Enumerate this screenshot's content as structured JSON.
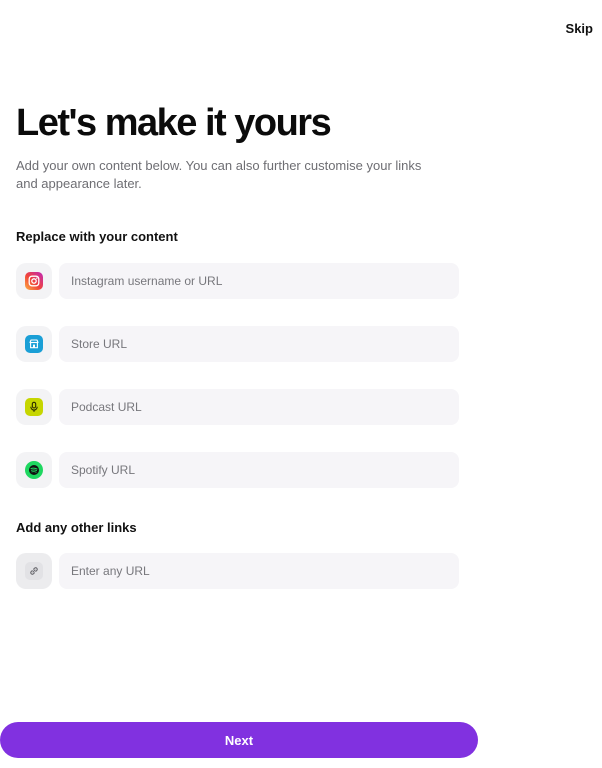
{
  "header": {
    "skip_label": "Skip"
  },
  "title": "Let's make it yours",
  "subtitle": "Add your own content below. You can also further customise your links and appearance later.",
  "replace_section": {
    "label": "Replace with your content",
    "items": [
      {
        "icon": "instagram-icon",
        "placeholder": "Instagram username or URL",
        "value": ""
      },
      {
        "icon": "store-icon",
        "placeholder": "Store URL",
        "value": ""
      },
      {
        "icon": "podcast-icon",
        "placeholder": "Podcast URL",
        "value": ""
      },
      {
        "icon": "spotify-icon",
        "placeholder": "Spotify URL",
        "value": ""
      }
    ]
  },
  "other_section": {
    "label": "Add any other links",
    "items": [
      {
        "icon": "link-icon",
        "placeholder": "Enter any URL",
        "value": ""
      }
    ]
  },
  "footer": {
    "next_label": "Next"
  },
  "colors": {
    "accent": "#8131e0",
    "instagram": "#e1306c",
    "store": "#1a9fd6",
    "podcast": "#c6d600",
    "spotify": "#1ed760"
  }
}
